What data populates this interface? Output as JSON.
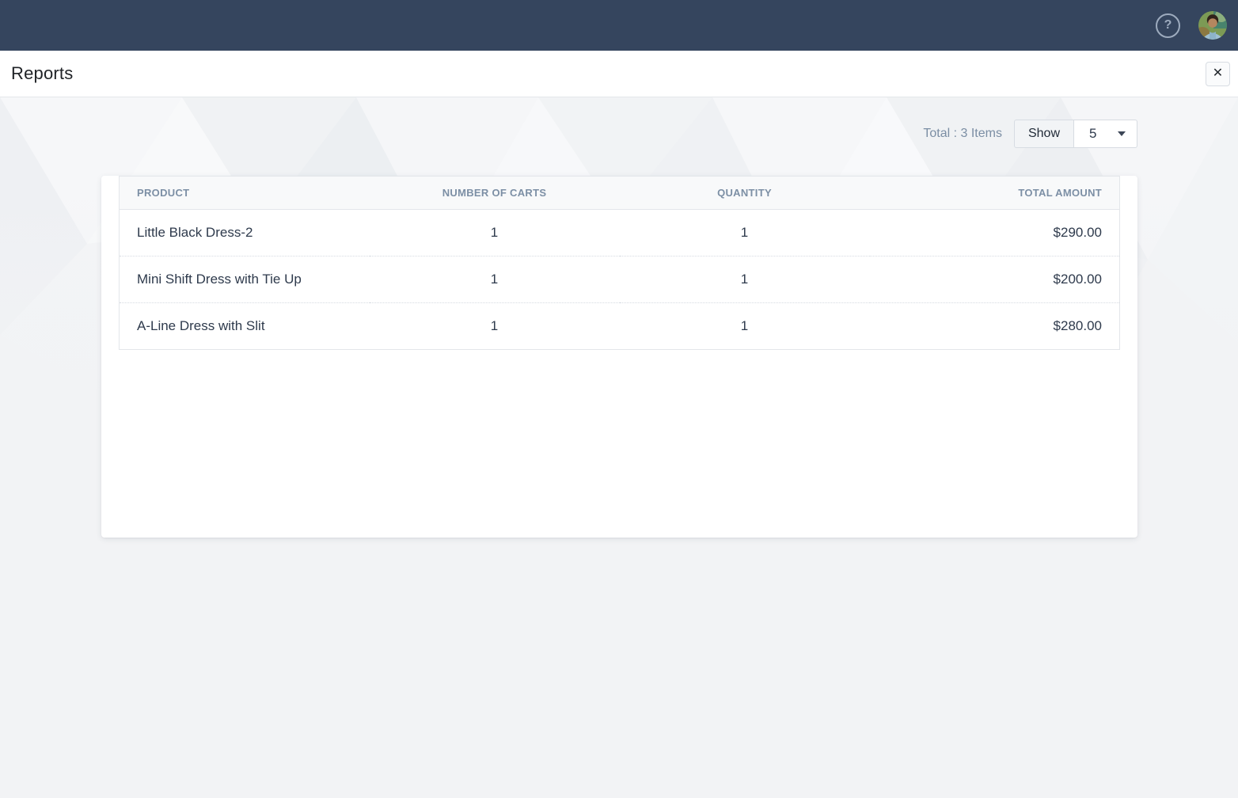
{
  "topbar": {
    "help_icon": "?"
  },
  "header": {
    "title": "Reports",
    "close_icon": "✕"
  },
  "toolbar": {
    "total_text": "Total : 3 Items",
    "show_label": "Show",
    "page_size": "5"
  },
  "table": {
    "columns": [
      {
        "label": "PRODUCT"
      },
      {
        "label": "NUMBER OF CARTS"
      },
      {
        "label": "QUANTITY"
      },
      {
        "label": "TOTAL AMOUNT"
      }
    ],
    "rows": [
      {
        "product": "Little Black Dress-2",
        "number_of_carts": "1",
        "quantity": "1",
        "total_amount": "$290.00"
      },
      {
        "product": "Mini Shift Dress with Tie Up",
        "number_of_carts": "1",
        "quantity": "1",
        "total_amount": "$200.00"
      },
      {
        "product": "A-Line Dress with Slit",
        "number_of_carts": "1",
        "quantity": "1",
        "total_amount": "$280.00"
      }
    ]
  },
  "colors": {
    "topbar": "#35455e",
    "page_background": "#f2f3f5",
    "muted_text": "#7b8ea4",
    "dark_text": "#2e3a4c",
    "table_border": "#e3e6ea"
  }
}
